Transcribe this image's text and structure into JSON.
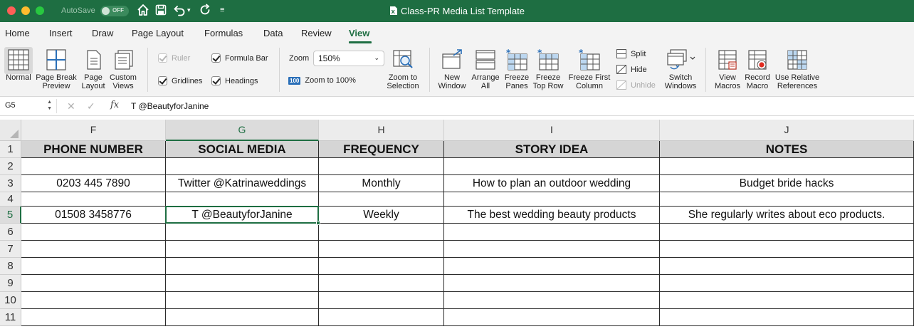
{
  "titlebar": {
    "autosave_label": "AutoSave",
    "autosave_state": "OFF",
    "document_title": "Class-PR Media List Template"
  },
  "tabs": [
    {
      "label": "Home"
    },
    {
      "label": "Insert"
    },
    {
      "label": "Draw"
    },
    {
      "label": "Page Layout"
    },
    {
      "label": "Formulas"
    },
    {
      "label": "Data"
    },
    {
      "label": "Review"
    },
    {
      "label": "View",
      "active": true
    }
  ],
  "ribbon": {
    "normal": "Normal",
    "page_break_1": "Page Break",
    "page_break_2": "Preview",
    "page_layout_1": "Page",
    "page_layout_2": "Layout",
    "custom_views_1": "Custom",
    "custom_views_2": "Views",
    "ruler": "Ruler",
    "formula_bar": "Formula Bar",
    "gridlines": "Gridlines",
    "headings": "Headings",
    "zoom_label": "Zoom",
    "zoom_value": "150%",
    "zoom_100_badge": "100",
    "zoom_100": "Zoom to 100%",
    "zoom_sel_1": "Zoom to",
    "zoom_sel_2": "Selection",
    "new_window_1": "New",
    "new_window_2": "Window",
    "arrange_all_1": "Arrange",
    "arrange_all_2": "All",
    "freeze_panes_1": "Freeze",
    "freeze_panes_2": "Panes",
    "freeze_top_1": "Freeze",
    "freeze_top_2": "Top Row",
    "freeze_first_1": "Freeze First",
    "freeze_first_2": "Column",
    "split": "Split",
    "hide": "Hide",
    "unhide": "Unhide",
    "switch_1": "Switch",
    "switch_2": "Windows",
    "view_macros_1": "View",
    "view_macros_2": "Macros",
    "record_macro_1": "Record",
    "record_macro_2": "Macro",
    "use_relative_1": "Use Relative",
    "use_relative_2": "References"
  },
  "formula_bar": {
    "name_box": "G5",
    "fx_label": "fx",
    "value": "T @BeautyforJanine"
  },
  "sheet": {
    "columns": [
      "F",
      "G",
      "H",
      "I",
      "J"
    ],
    "selected_column": "G",
    "selected_row": 5,
    "rows": [
      {
        "num": "1",
        "cells": [
          "PHONE NUMBER",
          "SOCIAL MEDIA",
          "FREQUENCY",
          "STORY IDEA",
          "NOTES"
        ],
        "header": true
      },
      {
        "num": "2",
        "cells": [
          "",
          "",
          "",
          "",
          ""
        ]
      },
      {
        "num": "3",
        "cells": [
          "0203 445 7890",
          "Twitter @Katrinaweddings",
          "Monthly",
          "How to plan an outdoor wedding",
          "Budget bride hacks"
        ]
      },
      {
        "num": "4",
        "cells": [
          "",
          "",
          "",
          "",
          ""
        ]
      },
      {
        "num": "5",
        "cells": [
          "01508 3458776",
          "T @BeautyforJanine",
          "Weekly",
          "The best wedding beauty products",
          "She regularly writes about eco products."
        ]
      },
      {
        "num": "6",
        "cells": [
          "",
          "",
          "",
          "",
          ""
        ]
      },
      {
        "num": "7",
        "cells": [
          "",
          "",
          "",
          "",
          ""
        ]
      },
      {
        "num": "8",
        "cells": [
          "",
          "",
          "",
          "",
          ""
        ]
      },
      {
        "num": "9",
        "cells": [
          "",
          "",
          "",
          "",
          ""
        ]
      },
      {
        "num": "10",
        "cells": [
          "",
          "",
          "",
          "",
          ""
        ]
      },
      {
        "num": "11",
        "cells": [
          "",
          "",
          "",
          "",
          ""
        ]
      }
    ]
  }
}
